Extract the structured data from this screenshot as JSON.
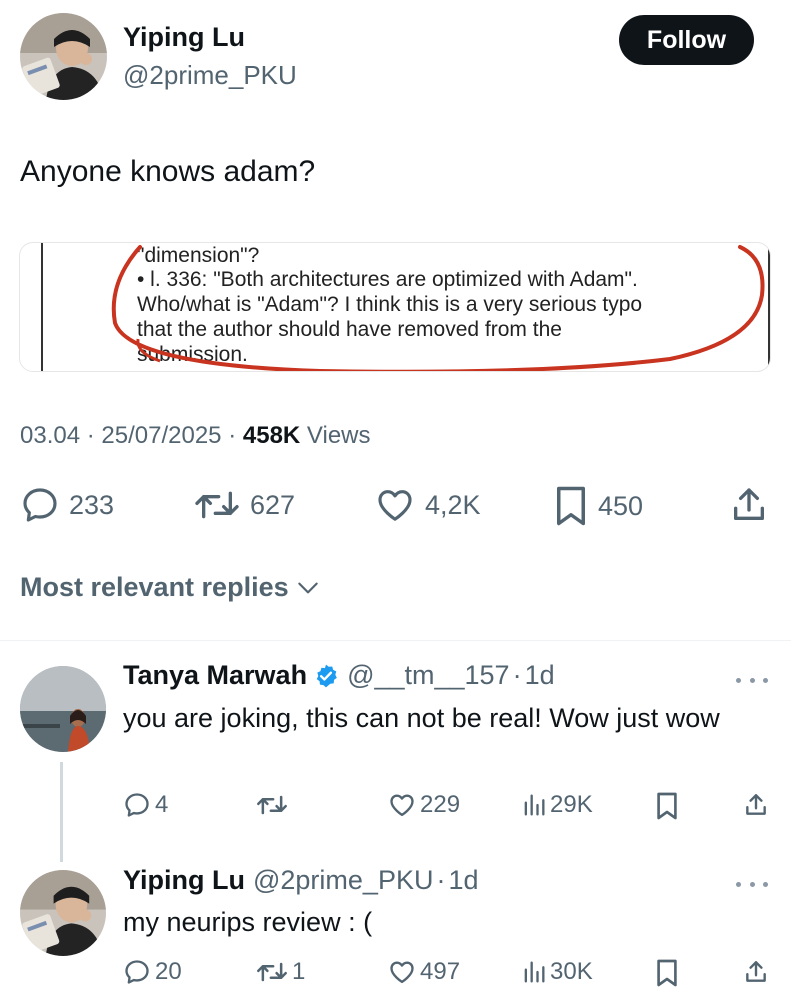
{
  "tweet": {
    "author_name": "Yiping Lu",
    "author_handle": "@2prime_PKU",
    "follow_label": "Follow",
    "text": "Anyone knows adam?",
    "media_lines": [
      "\"dimension\"?",
      "• l. 336: \"Both architectures are optimized with Adam\".",
      "Who/what is \"Adam\"? I think this is a very serious typo",
      "that the author should have removed from the",
      "submission."
    ],
    "time": "03.04",
    "date": "25/07/2025",
    "views_count": "458K",
    "views_label": "Views",
    "actions": {
      "replies": "233",
      "reposts": "627",
      "likes": "4,2K",
      "bookmarks": "450"
    }
  },
  "replies_sort_label": "Most relevant replies",
  "replies": [
    {
      "name": "Tanya Marwah",
      "verified": true,
      "handle": "@__tm__157",
      "time": "1d",
      "text": "you are joking, this can not be real! Wow just wow",
      "replies": "4",
      "reposts": "",
      "likes": "229",
      "views": "29K"
    },
    {
      "name": "Yiping Lu",
      "verified": false,
      "handle": "@2prime_PKU",
      "time": "1d",
      "text": "my neurips review : (",
      "replies": "20",
      "reposts": "1",
      "likes": "497",
      "views": "30K"
    }
  ],
  "colors": {
    "text": "#0f1419",
    "secondary": "#536471",
    "verified": "#1d9bf0",
    "annotation": "#c8341f"
  },
  "icons": [
    "reply-icon",
    "repost-icon",
    "like-icon",
    "bookmark-icon",
    "share-icon",
    "views-icon",
    "verified-badge-icon",
    "chevron-down-icon",
    "more-icon"
  ]
}
